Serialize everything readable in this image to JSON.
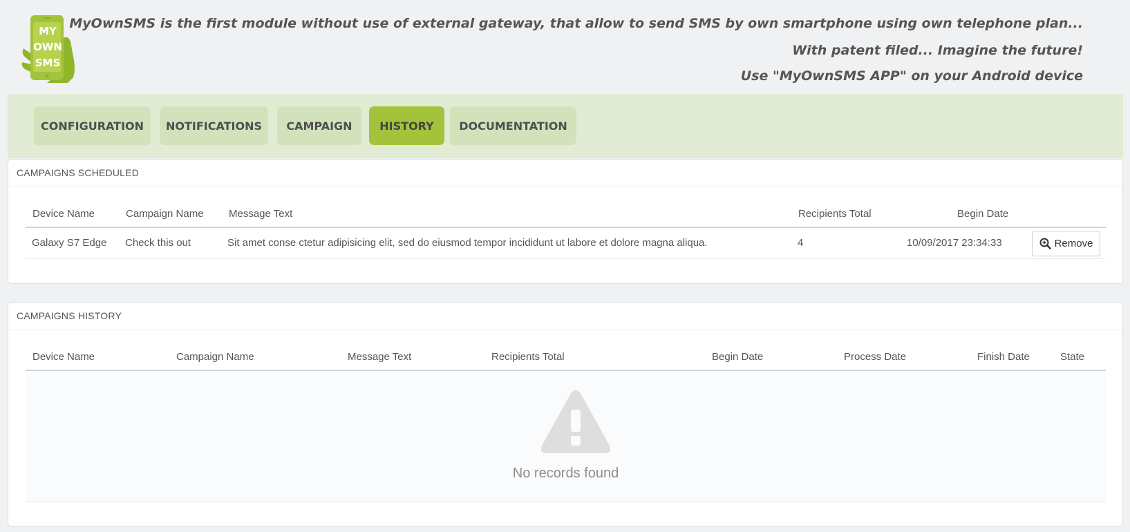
{
  "logo": {
    "line1": "MY",
    "line2": "OWN",
    "line3": "SMS"
  },
  "header": {
    "tagline1": "MyOwnSMS is the first module without use of external gateway, that allow to send SMS by own smartphone using own telephone plan...",
    "tagline2": "With patent filed... Imagine the future!",
    "tagline3": "Use \"MyOwnSMS APP\" on your Android device"
  },
  "tabs": [
    {
      "label": "CONFIGURATION"
    },
    {
      "label": "NOTIFICATIONS"
    },
    {
      "label": "CAMPAIGN"
    },
    {
      "label": "HISTORY",
      "active": true
    },
    {
      "label": "DOCUMENTATION"
    }
  ],
  "scheduled": {
    "title": "CAMPAIGNS SCHEDULED",
    "columns": [
      "Device Name",
      "Campaign Name",
      "Message Text",
      "Recipients Total",
      "Begin Date"
    ],
    "rows": [
      {
        "device": "Galaxy S7 Edge",
        "campaign": "Check this out",
        "message": "Sit amet conse ctetur adipisicing elit, sed do eiusmod tempor incididunt ut labore et dolore magna aliqua.",
        "recipients": "4",
        "begin": "10/09/2017 23:34:33",
        "action": "Remove"
      }
    ]
  },
  "history": {
    "title": "CAMPAIGNS HISTORY",
    "columns": [
      "Device Name",
      "Campaign Name",
      "Message Text",
      "Recipients Total",
      "Begin Date",
      "Process Date",
      "Finish Date",
      "State"
    ],
    "empty_text": "No records found"
  },
  "colors": {
    "accent": "#a3c33a",
    "tab_bg": "#d4e2bc",
    "tabbar_bg": "#e2ebd4"
  }
}
